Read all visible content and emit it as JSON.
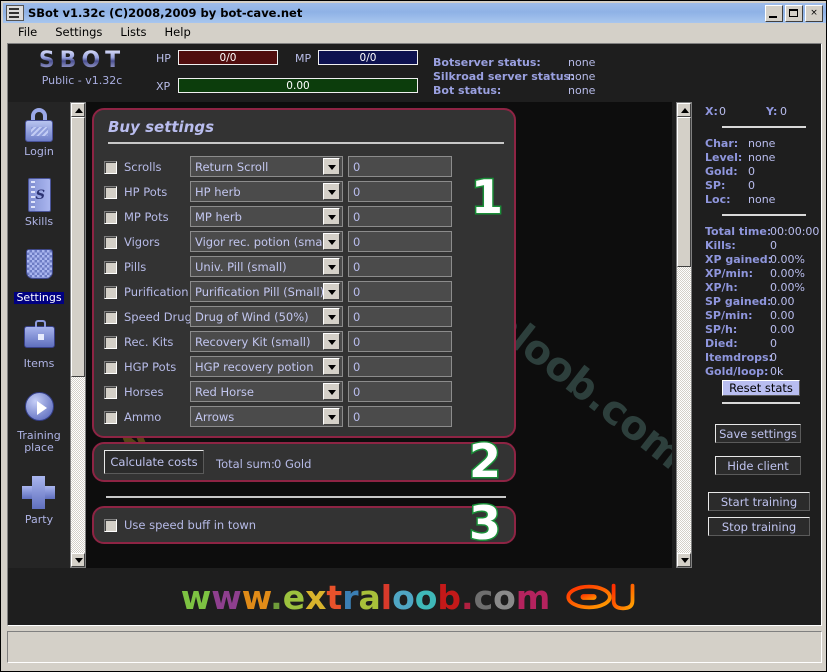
{
  "window": {
    "title": "SBot v1.32c (C)2008,2009 by bot-cave.net",
    "minimize_label": "_",
    "maximize_label": "",
    "close_label": "×"
  },
  "menu": {
    "items": [
      "File",
      "Settings",
      "Lists",
      "Help"
    ]
  },
  "header": {
    "logo_text": "SBOT",
    "logo_sub": "Public - v1.32c",
    "hp_label": "HP",
    "hp_value": "0/0",
    "mp_label": "MP",
    "mp_value": "0/0",
    "xp_label": "XP",
    "xp_value": "0.00",
    "statuses": [
      {
        "label": "Botserver status:",
        "value": "none"
      },
      {
        "label": "Silkroad server status:",
        "value": "none"
      },
      {
        "label": "Bot status:",
        "value": "none"
      }
    ]
  },
  "sidebar": {
    "items": [
      {
        "label": "Login",
        "icon": "lock-icon",
        "selected": false
      },
      {
        "label": "Skills",
        "icon": "book-icon",
        "selected": false
      },
      {
        "label": "Settings",
        "icon": "gear-icon",
        "selected": true
      },
      {
        "label": "Items",
        "icon": "briefcase-icon",
        "selected": false
      },
      {
        "label": "Training place",
        "icon": "play-icon",
        "selected": false
      },
      {
        "label": "Party",
        "icon": "plus-icon",
        "selected": false
      }
    ]
  },
  "buy_settings": {
    "title": "Buy settings",
    "rows": [
      {
        "label": "Scrolls",
        "item": "Return Scroll",
        "qty": "0",
        "checked": false
      },
      {
        "label": "HP Pots",
        "item": "HP herb",
        "qty": "0",
        "checked": false
      },
      {
        "label": "MP Pots",
        "item": "MP herb",
        "qty": "0",
        "checked": false
      },
      {
        "label": "Vigors",
        "item": "Vigor rec. potion (small)",
        "qty": "0",
        "checked": false
      },
      {
        "label": "Pills",
        "item": "Univ. Pill (small)",
        "qty": "0",
        "checked": false
      },
      {
        "label": "Purification pills",
        "item": "Purification Pill (Small)",
        "qty": "0",
        "checked": false
      },
      {
        "label": "Speed Drugs",
        "item": "Drug of Wind (50%)",
        "qty": "0",
        "checked": false
      },
      {
        "label": "Rec. Kits",
        "item": "Recovery Kit (small)",
        "qty": "0",
        "checked": false
      },
      {
        "label": "HGP Pots",
        "item": "HGP recovery potion",
        "qty": "0",
        "checked": false
      },
      {
        "label": "Horses",
        "item": "Red Horse",
        "qty": "0",
        "checked": false
      },
      {
        "label": "Ammo",
        "item": "Arrows",
        "qty": "0",
        "checked": false
      }
    ]
  },
  "costs": {
    "calculate_label": "Calculate costs",
    "total_label": "Total sum:",
    "total_value": "0 Gold"
  },
  "speed_buff": {
    "label": "Use speed buff in town",
    "checked": false
  },
  "annotations": [
    "1",
    "2",
    "3"
  ],
  "stats": {
    "coord_x_label": "X:",
    "coord_x_value": "0",
    "coord_y_label": "Y:",
    "coord_y_value": "0",
    "char_rows": [
      {
        "label": "Char:",
        "value": "none"
      },
      {
        "label": "Level:",
        "value": "none"
      },
      {
        "label": "Gold:",
        "value": "0"
      },
      {
        "label": "SP:",
        "value": "0"
      },
      {
        "label": "Loc:",
        "value": "none"
      }
    ],
    "session_rows": [
      {
        "label": "Total time:",
        "value": "00:00:00"
      },
      {
        "label": "Kills:",
        "value": "0"
      },
      {
        "label": "XP gained:",
        "value": "0.00%"
      },
      {
        "label": "XP/min:",
        "value": "0.00%"
      },
      {
        "label": "XP/h:",
        "value": "0.00%"
      },
      {
        "label": "SP gained:",
        "value": "0.00"
      },
      {
        "label": "SP/min:",
        "value": "0.00"
      },
      {
        "label": "SP/h:",
        "value": "0.00"
      },
      {
        "label": "Died:",
        "value": "0"
      },
      {
        "label": "Itemdrops:",
        "value": "0"
      },
      {
        "label": "Gold/loop:",
        "value": "0k"
      }
    ],
    "reset_label": "Reset stats",
    "buttons": [
      "Save settings",
      "Hide client",
      "Start training",
      "Stop training"
    ]
  },
  "watermark": {
    "diagonal_text": "www.extraloob.com",
    "bottom_text": "www.extraloob.com",
    "bottom_letters": [
      {
        "ch": "w",
        "color": "#7dc242"
      },
      {
        "ch": "w",
        "color": "#8e3f8e"
      },
      {
        "ch": "w",
        "color": "#e08b18"
      },
      {
        "ch": ".",
        "color": "#6f9c3a"
      },
      {
        "ch": "e",
        "color": "#9cc23e"
      },
      {
        "ch": "x",
        "color": "#d9b32c"
      },
      {
        "ch": "t",
        "color": "#e8522b"
      },
      {
        "ch": "r",
        "color": "#3b7fb5"
      },
      {
        "ch": "a",
        "color": "#a8c03a"
      },
      {
        "ch": "l",
        "color": "#d93a2b"
      },
      {
        "ch": "o",
        "color": "#4fa6c4"
      },
      {
        "ch": "o",
        "color": "#3fb8b8"
      },
      {
        "ch": "b",
        "color": "#c41919"
      },
      {
        "ch": ".",
        "color": "#b02040"
      },
      {
        "ch": "c",
        "color": "#6e6e6e"
      },
      {
        "ch": "o",
        "color": "#8a8a8a"
      },
      {
        "ch": "m",
        "color": "#b4235e"
      }
    ]
  },
  "colors": {
    "accent_border": "#8e2444",
    "panel_bg": "#333333",
    "client_bg": "#1e1e1e",
    "label_blue": "#8f96dd",
    "value_blue": "#b9bdee",
    "annotation_green": "#1a8f38",
    "hp_bar": "#500d0d",
    "mp_bar": "#0d1250",
    "xp_bar": "#0c3d0c"
  }
}
